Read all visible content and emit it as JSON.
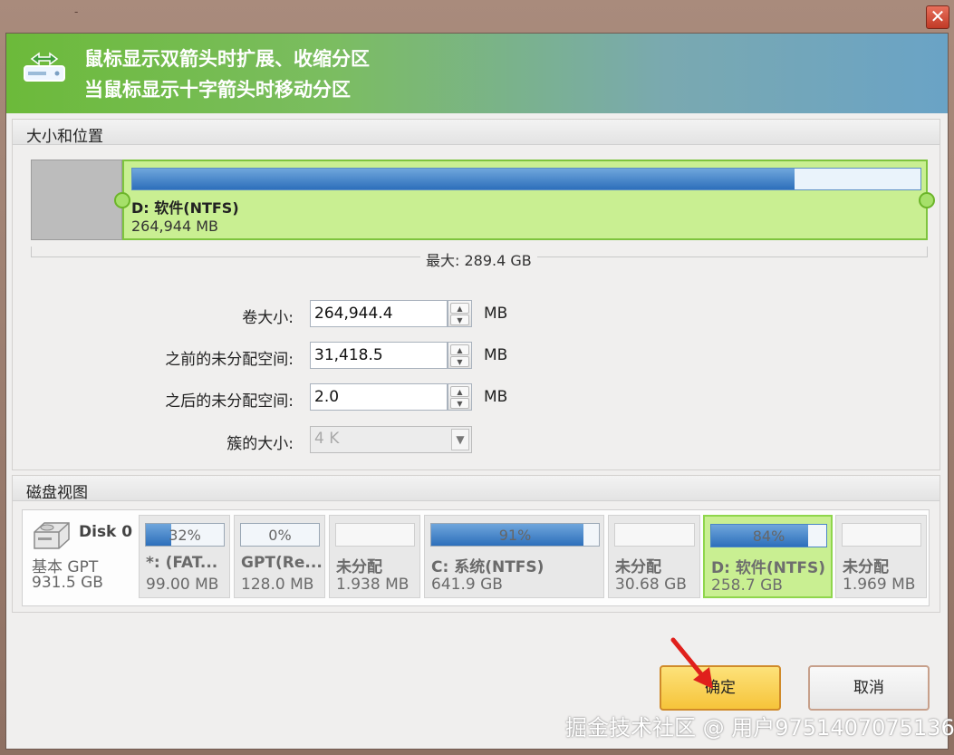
{
  "window": {
    "title": "-",
    "close_label": "✕"
  },
  "banner": {
    "line1": "鼠标显示双箭头时扩展、收缩分区",
    "line2": "当鼠标显示十字箭头时移动分区"
  },
  "size_position": {
    "title": "大小和位置",
    "partition_name": "D: 软件(NTFS)",
    "partition_size": "264,944 MB",
    "usage_fraction": 0.84,
    "max_label": "最大: 289.4 GB"
  },
  "fields": {
    "volume_size_label": "卷大小:",
    "volume_size_value": "264,944.4",
    "volume_size_unit": "MB",
    "before_label": "之前的未分配空间:",
    "before_value": "31,418.5",
    "before_unit": "MB",
    "after_label": "之后的未分配空间:",
    "after_value": "2.0",
    "after_unit": "MB",
    "cluster_label": "簇的大小:",
    "cluster_value": "4 K"
  },
  "disk_map": {
    "title": "磁盘视图",
    "disk_name": "Disk 0",
    "disk_type": "基本 GPT",
    "disk_capacity": "931.5 GB",
    "partitions": [
      {
        "label": "32%",
        "name": "*: (FAT...",
        "size": "99.00 MB",
        "fill": 0.32,
        "kind": "used"
      },
      {
        "label": "0%",
        "name": "GPT(Re...",
        "size": "128.0 MB",
        "fill": 0.0,
        "kind": "used"
      },
      {
        "label": "",
        "name": "未分配",
        "size": "1.938 MB",
        "fill": 0,
        "kind": "unallocated"
      },
      {
        "label": "91%",
        "name": "C: 系统(NTFS)",
        "size": "641.9 GB",
        "fill": 0.91,
        "kind": "used"
      },
      {
        "label": "",
        "name": "未分配",
        "size": "30.68 GB",
        "fill": 0,
        "kind": "unallocated"
      },
      {
        "label": "84%",
        "name": "D: 软件(NTFS)",
        "size": "258.7 GB",
        "fill": 0.84,
        "kind": "selected"
      },
      {
        "label": "",
        "name": "未分配",
        "size": "1.969 MB",
        "fill": 0,
        "kind": "unallocated"
      }
    ]
  },
  "buttons": {
    "ok": "确定",
    "cancel": "取消"
  },
  "watermark": "掘金技术社区 @ 用户9751407075136",
  "colors": {
    "accent_green": "#7ec43e",
    "selected_fill": "#c9ef92",
    "bar_blue": "#2d6fbb",
    "ok_button": "#f6c43a"
  }
}
